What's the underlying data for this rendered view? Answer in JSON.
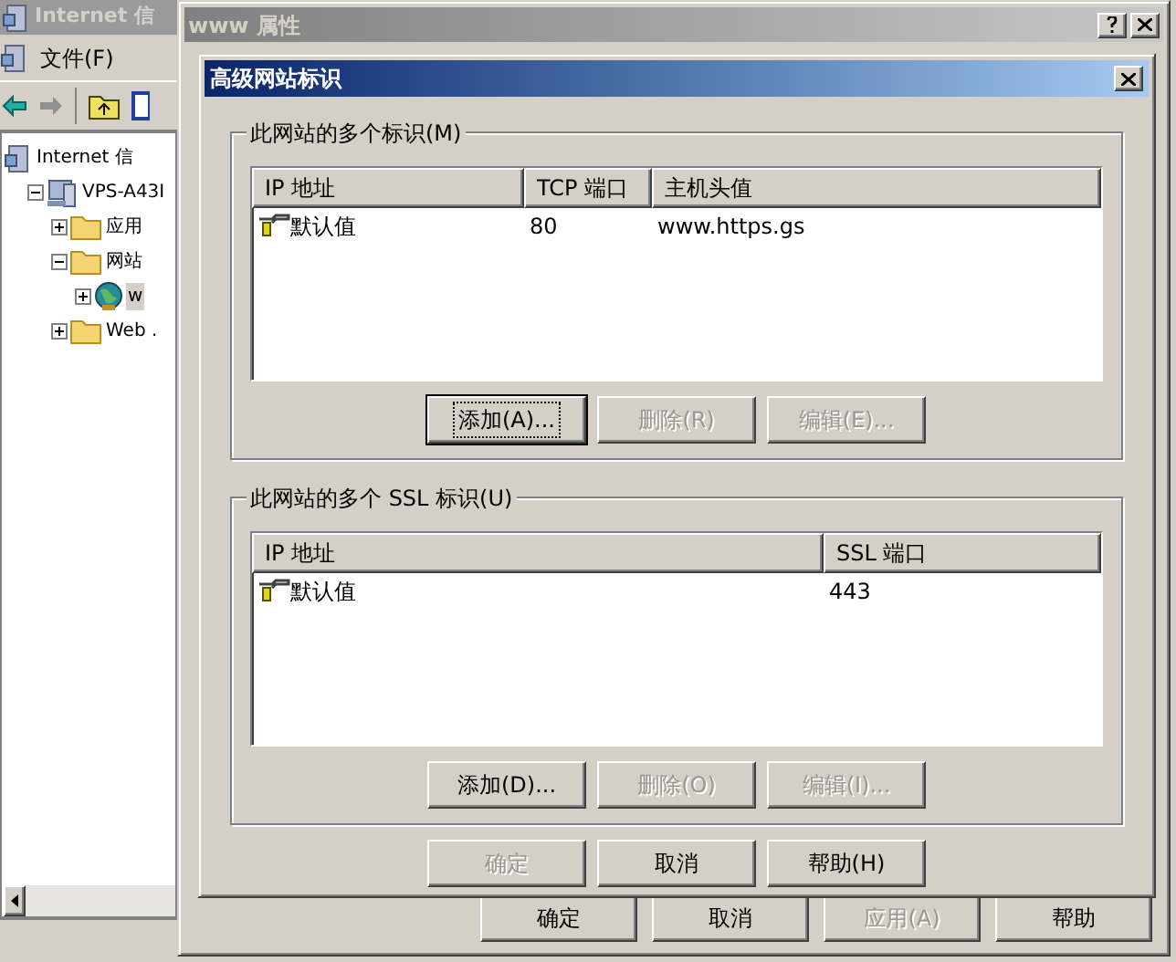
{
  "background_window": {
    "title": "Internet 信",
    "menu": [
      "文件(F)"
    ],
    "tree": [
      {
        "label": "Internet 信",
        "kind": "service",
        "selected": false,
        "children": [
          {
            "label": "VPS-A43I",
            "kind": "server",
            "expanded": true,
            "selected": false,
            "children": [
              {
                "label": "应用",
                "kind": "folder",
                "expanded": false,
                "selected": false
              },
              {
                "label": "网站",
                "kind": "folder",
                "expanded": true,
                "selected": false,
                "children": [
                  {
                    "label": "w",
                    "kind": "site",
                    "expanded": false,
                    "selected": true
                  }
                ]
              },
              {
                "label": "Web .",
                "kind": "folder",
                "expanded": false,
                "selected": false
              }
            ]
          }
        ]
      }
    ]
  },
  "properties_dialog": {
    "title": "www 属性",
    "buttons": [
      {
        "label": "确定",
        "disabled": false
      },
      {
        "label": "取消",
        "disabled": false
      },
      {
        "label": "应用(A)",
        "disabled": true
      },
      {
        "label": "帮助",
        "disabled": false
      }
    ]
  },
  "advanced_dialog": {
    "title": "高级网站标识",
    "groups": [
      {
        "label": "此网站的多个标识(M)",
        "columns": [
          "IP 地址",
          "TCP 端口",
          "主机头值"
        ],
        "rows": [
          {
            "cells": [
              "默认值",
              "80",
              "www.https.gs"
            ]
          }
        ],
        "buttons": [
          {
            "label": "添加(A)...",
            "disabled": false,
            "focused": true
          },
          {
            "label": "删除(R)",
            "disabled": true,
            "focused": false
          },
          {
            "label": "编辑(E)...",
            "disabled": true,
            "focused": false
          }
        ]
      },
      {
        "label": "此网站的多个 SSL 标识(U)",
        "columns": [
          "IP 地址",
          "SSL 端口"
        ],
        "rows": [
          {
            "cells": [
              "默认值",
              "443"
            ]
          }
        ],
        "buttons": [
          {
            "label": "添加(D)...",
            "disabled": false,
            "focused": false
          },
          {
            "label": "删除(O)",
            "disabled": true,
            "focused": false
          },
          {
            "label": "编辑(I)...",
            "disabled": true,
            "focused": false
          }
        ]
      }
    ],
    "buttons": [
      {
        "label": "确定",
        "disabled": true
      },
      {
        "label": "取消",
        "disabled": false
      },
      {
        "label": "帮助(H)",
        "disabled": false
      }
    ]
  }
}
